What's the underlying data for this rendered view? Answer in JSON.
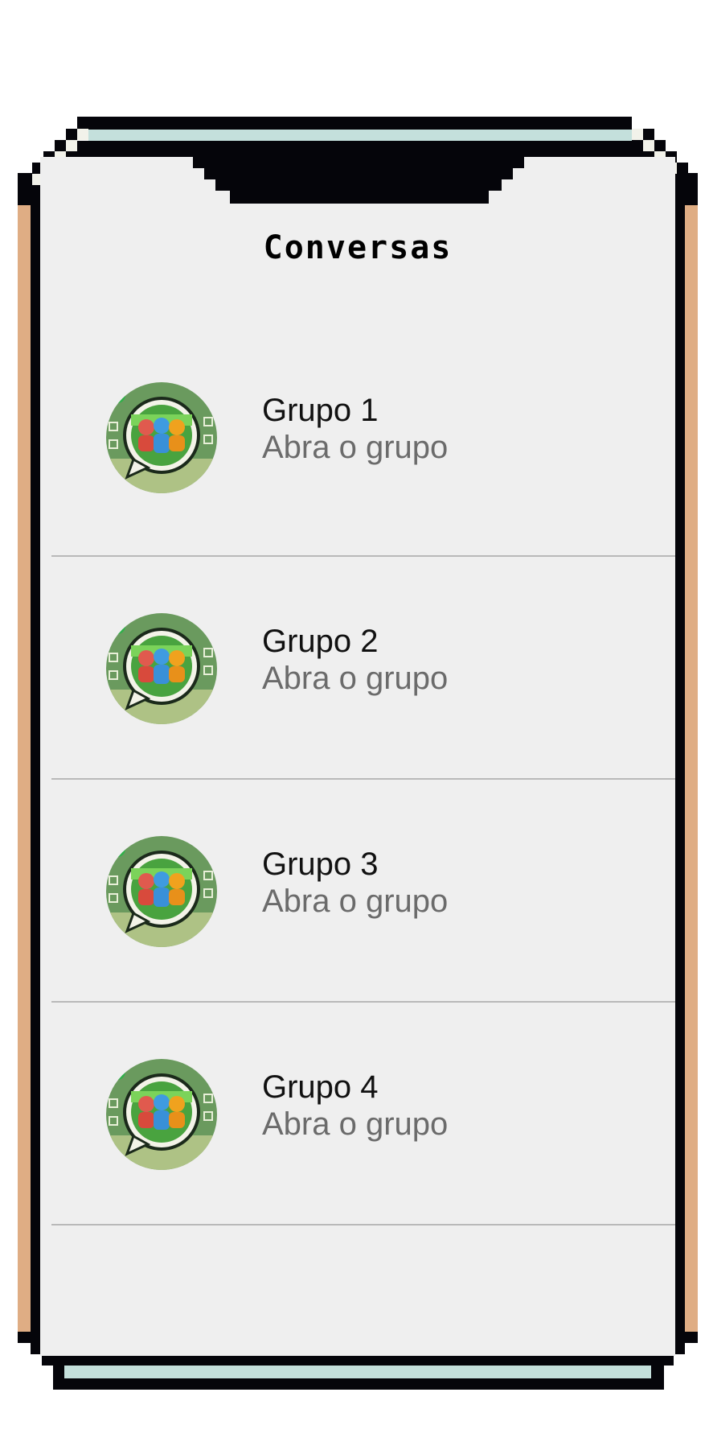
{
  "header": {
    "title": "Conversas"
  },
  "chats": [
    {
      "name": "Grupo 1",
      "subtitle": "Abra o grupo",
      "avatar_icon": "group-chat-icon"
    },
    {
      "name": "Grupo 2",
      "subtitle": "Abra o grupo",
      "avatar_icon": "group-chat-icon"
    },
    {
      "name": "Grupo 3",
      "subtitle": "Abra o grupo",
      "avatar_icon": "group-chat-icon"
    },
    {
      "name": "Grupo 4",
      "subtitle": "Abra o grupo",
      "avatar_icon": "group-chat-icon"
    }
  ],
  "colors": {
    "frame": "#05050a",
    "frame_side": "#dfad84",
    "frame_glass": "#c4e0dc",
    "screen_bg": "#efefef",
    "divider": "#b9b9b9"
  }
}
